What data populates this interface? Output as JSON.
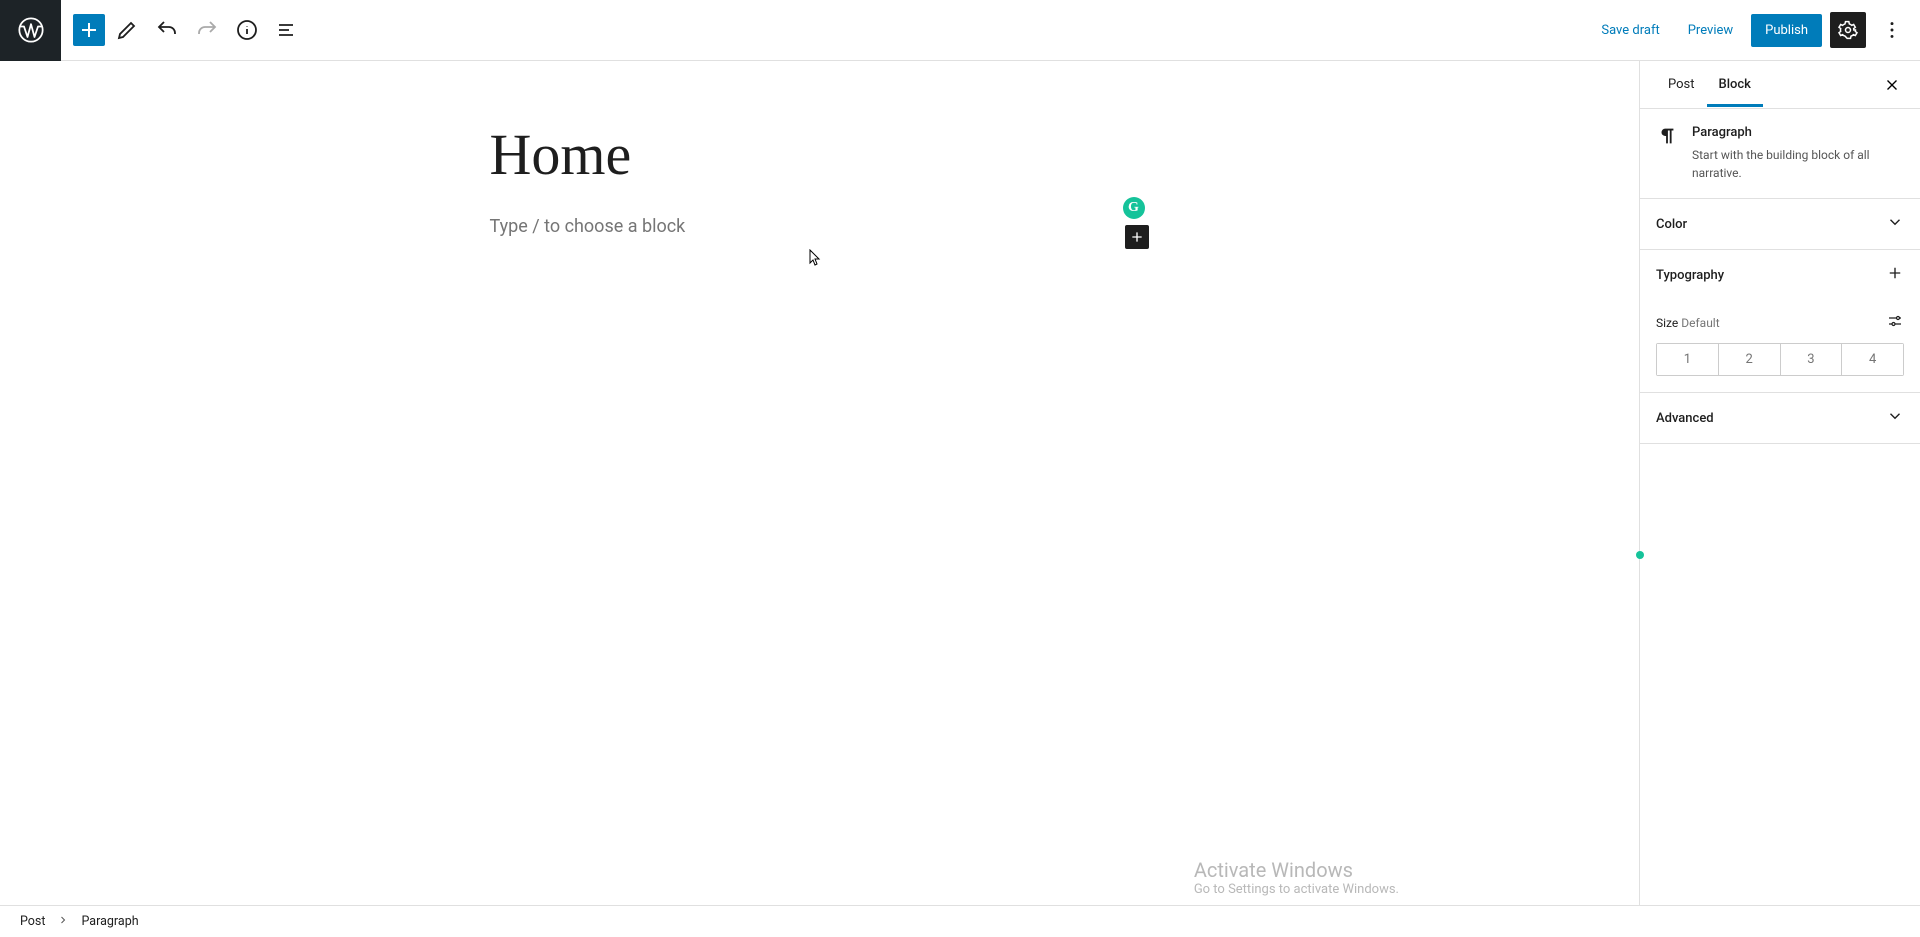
{
  "toolbar": {
    "save_draft": "Save draft",
    "preview": "Preview",
    "publish": "Publish"
  },
  "editor": {
    "title": "Home",
    "placeholder": "Type / to choose a block",
    "grammarly_glyph": "G"
  },
  "sidebar": {
    "tabs": {
      "post": "Post",
      "block": "Block"
    },
    "block": {
      "name": "Paragraph",
      "description": "Start with the building block of all narrative."
    },
    "panels": {
      "color": "Color",
      "typography": "Typography",
      "advanced": "Advanced"
    },
    "typography": {
      "size_label": "Size",
      "size_value": "Default",
      "presets": [
        "1",
        "2",
        "3",
        "4"
      ]
    }
  },
  "breadcrumb": {
    "root": "Post",
    "current": "Paragraph"
  },
  "watermark": {
    "line1": "Activate Windows",
    "line2": "Go to Settings to activate Windows."
  }
}
